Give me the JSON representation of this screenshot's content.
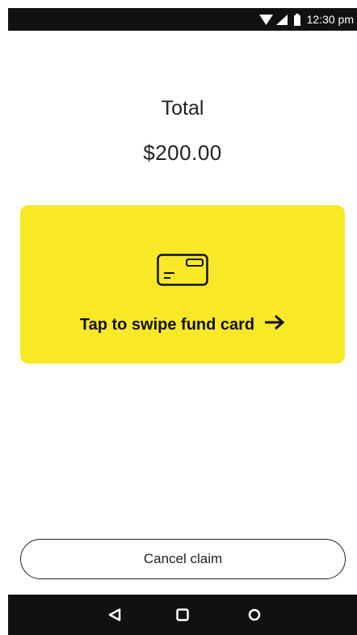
{
  "status_bar": {
    "time": "12:30 pm",
    "icons": [
      "wifi-icon",
      "cellular-signal-icon",
      "battery-icon"
    ]
  },
  "payment": {
    "total_label": "Total",
    "total_amount": "$200.00"
  },
  "swipe_card": {
    "label": "Tap to swipe fund card",
    "icon": "credit-card-icon",
    "arrow_icon": "arrow-right-icon",
    "background_color": "#f9e825"
  },
  "cancel": {
    "label": "Cancel claim"
  },
  "navigation": {
    "buttons": [
      "back-icon",
      "home-icon",
      "recents-icon"
    ]
  }
}
